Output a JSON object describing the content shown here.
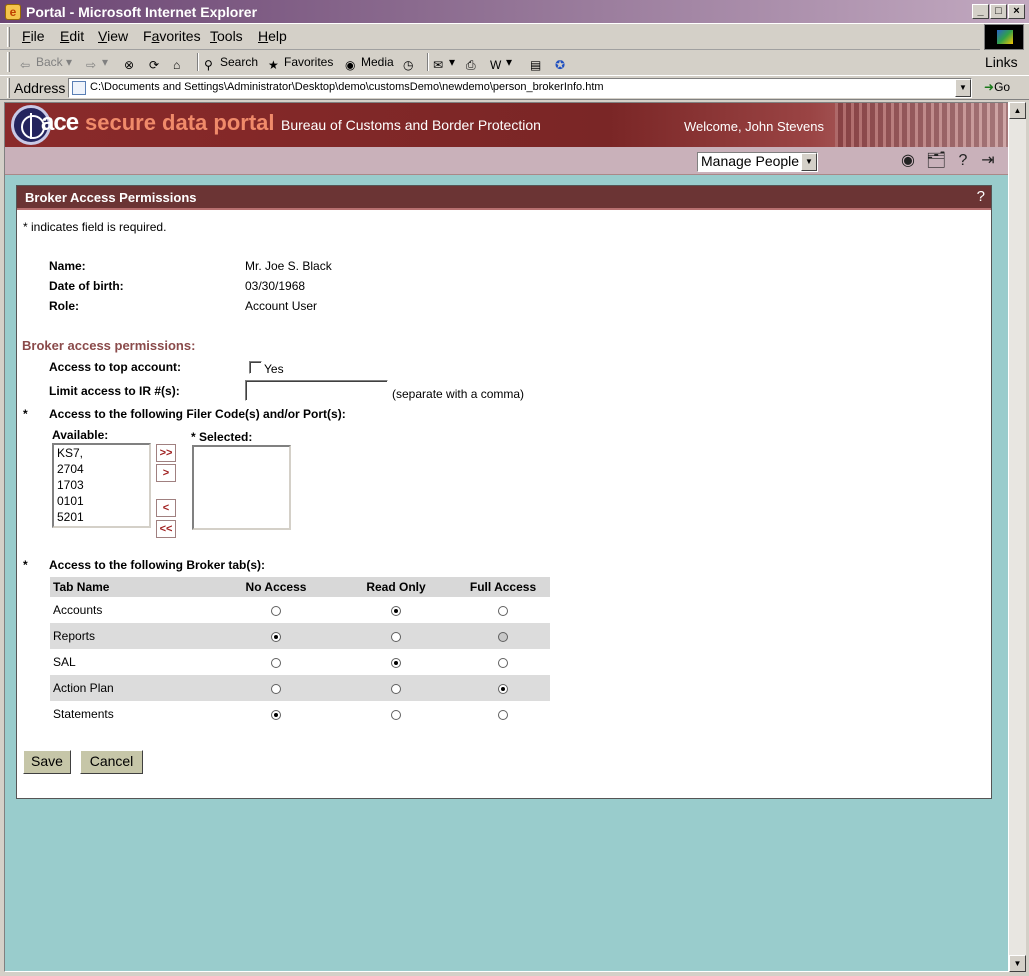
{
  "window": {
    "title": "Portal - Microsoft Internet Explorer",
    "controls": [
      "_",
      "□",
      "×"
    ]
  },
  "menu": [
    {
      "label": "File",
      "key": "F",
      "rest": "ile"
    },
    {
      "label": "Edit",
      "key": "E",
      "rest": "dit"
    },
    {
      "label": "View",
      "key": "V",
      "rest": "iew"
    },
    {
      "label": "Favorites",
      "key": "a",
      "pre": "F",
      "rest": "vorites"
    },
    {
      "label": "Tools",
      "key": "T",
      "rest": "ools"
    },
    {
      "label": "Help",
      "key": "H",
      "rest": "elp"
    }
  ],
  "toolbar": {
    "back": "Back",
    "search": "Search",
    "favorites": "Favorites",
    "media": "Media",
    "links": "Links"
  },
  "address": {
    "label": "Address",
    "url": "C:\\Documents and Settings\\Administrator\\Desktop\\demo\\customsDemo\\newdemo\\person_brokerInfo.htm",
    "go": "Go"
  },
  "portal": {
    "logo_ace": "ace",
    "logo_rest": "secure data portal",
    "agency": "Bureau of Customs and Border Protection",
    "welcome": "Welcome, John Stevens",
    "nav_select": "Manage People"
  },
  "panel": {
    "title": "Broker Access Permissions",
    "help": "?",
    "required_note": "* indicates field is required.",
    "person": {
      "name_label": "Name:",
      "name_value": "Mr. Joe S. Black",
      "dob_label": "Date of birth:",
      "dob_value": "03/30/1968",
      "role_label": "Role:",
      "role_value": "Account User"
    },
    "permissions_title": "Broker access permissions:",
    "top_account_label": "Access to top account:",
    "top_account_option": "Yes",
    "top_account_checked": false,
    "limit_ir_label": "Limit access to IR #(s):",
    "limit_ir_value": "",
    "limit_ir_hint": "(separate with a comma)",
    "required_star": "*",
    "filer_label": "Access to the following Filer Code(s) and/or Port(s):",
    "available_label": "Available:",
    "selected_label": "* Selected:",
    "available": [
      "KS7,",
      "2704",
      "1703",
      "0101",
      "5201"
    ],
    "selected": [],
    "move_buttons": [
      ">>",
      ">",
      "<",
      "<<"
    ],
    "tabs_label": "Access to the following Broker tab(s):",
    "tabs_table": {
      "headers": [
        "Tab Name",
        "No Access",
        "Read Only",
        "Full Access"
      ],
      "rows": [
        {
          "name": "Accounts",
          "selected": "Read Only"
        },
        {
          "name": "Reports",
          "selected": "No Access"
        },
        {
          "name": "SAL",
          "selected": "Read Only"
        },
        {
          "name": "Action Plan",
          "selected": "Full Access"
        },
        {
          "name": "Statements",
          "selected": "No Access"
        }
      ]
    },
    "save_label": "Save",
    "cancel_label": "Cancel"
  }
}
